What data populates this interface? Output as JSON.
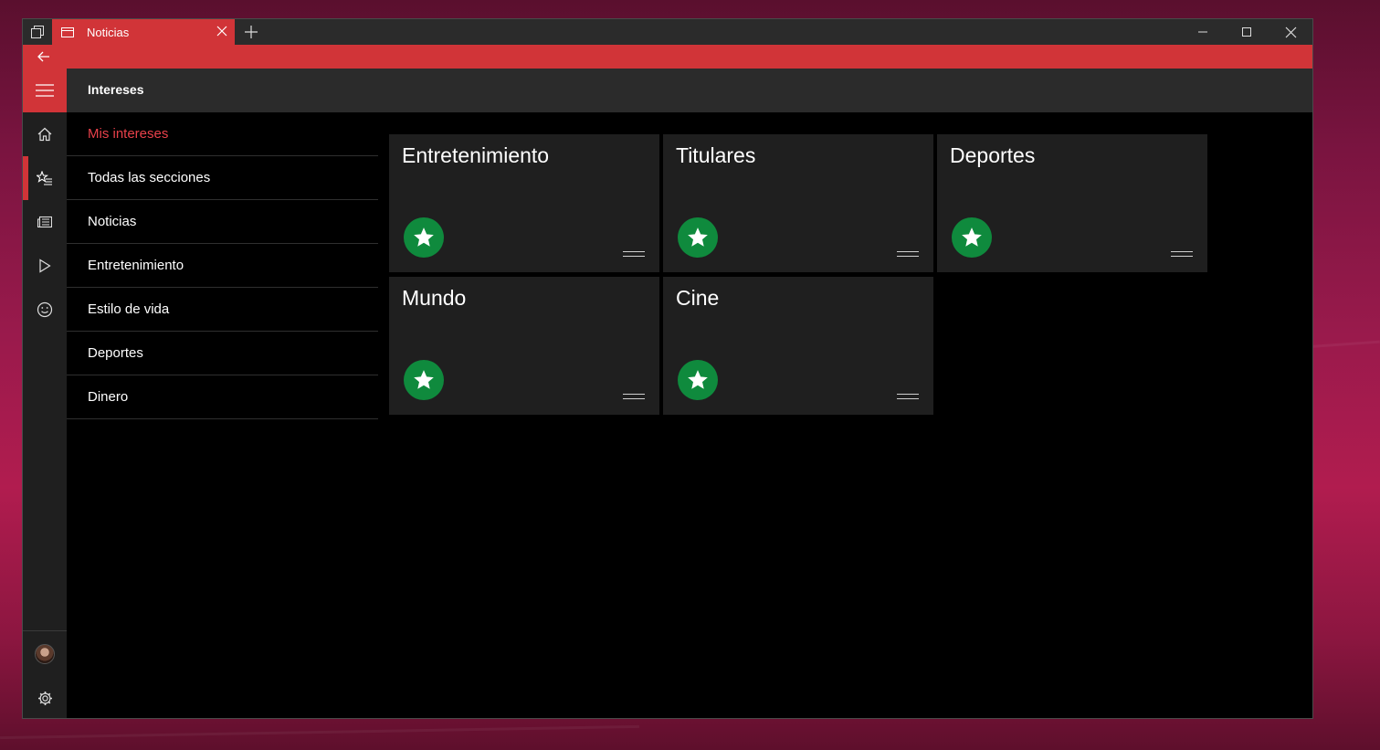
{
  "window": {
    "tab_title": "Noticias",
    "tab_icon": "page-icon",
    "accent_color": "#d13438"
  },
  "header": {
    "title": "Intereses"
  },
  "rail": {
    "items": [
      {
        "name": "home-icon"
      },
      {
        "name": "interests-icon",
        "selected": true
      },
      {
        "name": "news-icon"
      },
      {
        "name": "video-icon"
      },
      {
        "name": "smiley-icon"
      }
    ],
    "bottom": [
      {
        "name": "avatar"
      },
      {
        "name": "settings-icon"
      }
    ]
  },
  "sections": [
    {
      "label": "Mis intereses",
      "active": true
    },
    {
      "label": "Todas las secciones"
    },
    {
      "label": "Noticias"
    },
    {
      "label": "Entretenimiento"
    },
    {
      "label": "Estilo de vida"
    },
    {
      "label": "Deportes"
    },
    {
      "label": "Dinero"
    }
  ],
  "tiles": [
    {
      "title": "Entretenimiento"
    },
    {
      "title": "Titulares"
    },
    {
      "title": "Deportes"
    },
    {
      "title": "Mundo"
    },
    {
      "title": "Cine"
    }
  ],
  "star_color": "#0f8a3d"
}
